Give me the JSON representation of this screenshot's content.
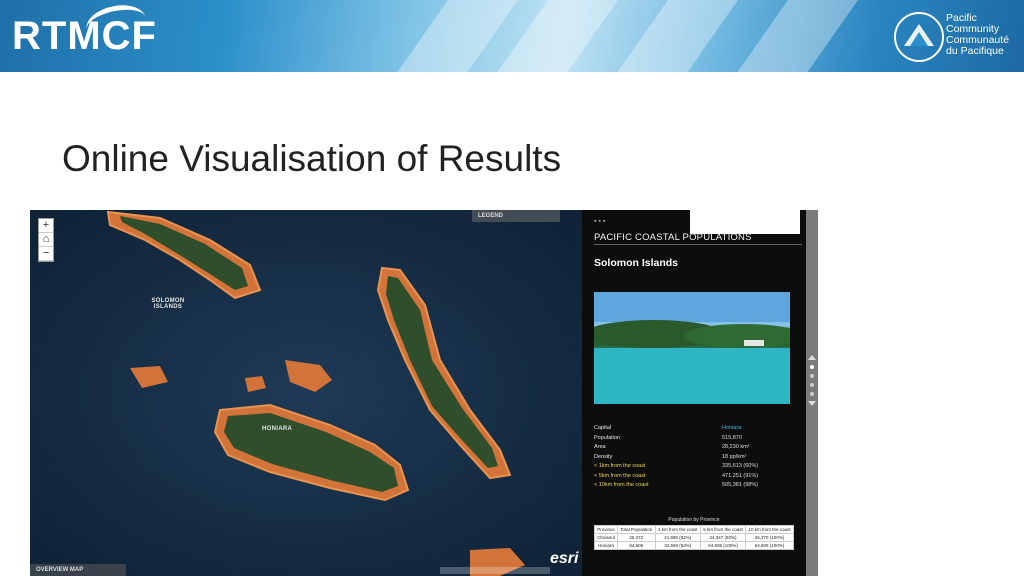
{
  "header": {
    "logo_text": "RTMCF",
    "org_lines": [
      "Pacific",
      "Community",
      "Communauté",
      "du Pacifique"
    ]
  },
  "slide": {
    "title": "Online Visualisation of Results"
  },
  "map": {
    "legend_label": "LEGEND",
    "labels": {
      "solomon": "SOLOMON ISLANDS",
      "honiara": "HONIARA"
    },
    "overview_label": "OVERVIEW MAP",
    "esri": "esri",
    "zoom_in": "+",
    "zoom_out": "−",
    "colors": {
      "ocean": "#142b42",
      "land": "#2c4a2a",
      "buffer": "#d2743a"
    }
  },
  "panel": {
    "title": "PACIFIC COASTAL POPULATIONS",
    "country": "Solomon Islands",
    "facts": [
      {
        "k": "Capital",
        "v": "Honiara",
        "highlight": false
      },
      {
        "k": "Population",
        "v": "515,870",
        "highlight": false
      },
      {
        "k": "Area",
        "v": "28,230 km²",
        "highlight": false
      },
      {
        "k": "Density",
        "v": "18 pp/km²",
        "highlight": false
      },
      {
        "k": "< 1km from the coast",
        "v": "335,613 (60%)",
        "highlight": true
      },
      {
        "k": "< 5km from the coast",
        "v": "471,251 (91%)",
        "highlight": true
      },
      {
        "k": "< 10km from the coast",
        "v": "505,381 (98%)",
        "highlight": true
      }
    ],
    "table_title": "Population by Province",
    "table_headers": [
      "Province",
      "Total Population",
      "1 km from the coast",
      "5 km from the coast",
      "10 km from the coast"
    ],
    "table_rows": [
      [
        "Choiseul",
        "26,372",
        "21,690 (82%)",
        "24,347 (93%)",
        "26,370 (100%)"
      ],
      [
        "Honiara",
        "64,609",
        "34,568 (53%)",
        "64,606 (100%)",
        "64,606 (100%)"
      ]
    ]
  }
}
